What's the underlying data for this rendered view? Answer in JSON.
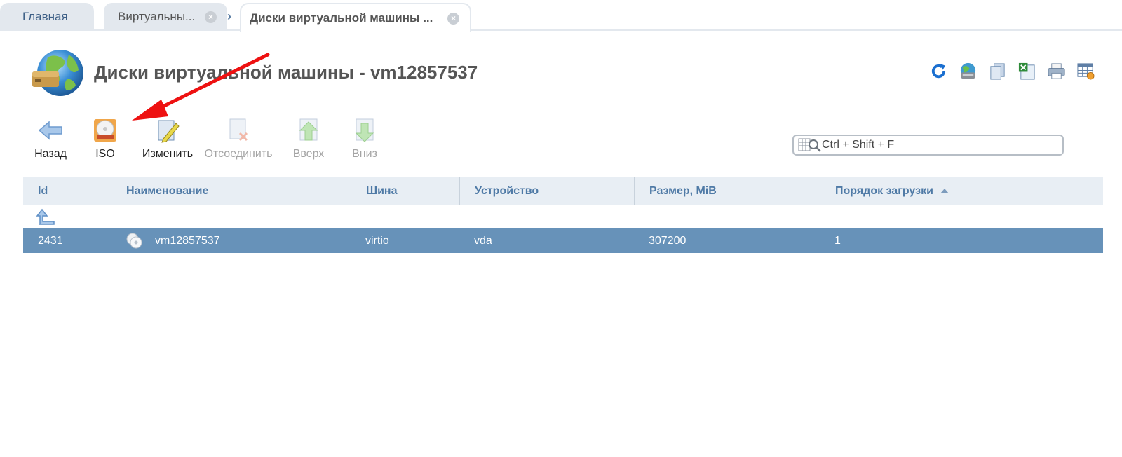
{
  "tabs": {
    "home": "Главная",
    "vm": "Виртуальны...",
    "current": "Диски виртуальной машины ..."
  },
  "page": {
    "title": "Диски виртуальной машины - vm12857537"
  },
  "top_actions": [
    {
      "icon": "refresh-icon"
    },
    {
      "icon": "globe-disk-icon"
    },
    {
      "icon": "copy-icon"
    },
    {
      "icon": "excel-export-icon"
    },
    {
      "icon": "print-icon"
    },
    {
      "icon": "table-settings-icon"
    }
  ],
  "toolbar": {
    "back": "Назад",
    "iso": "ISO",
    "edit": "Изменить",
    "detach": "Отсоединить",
    "up": "Вверх",
    "down": "Вниз"
  },
  "search": {
    "placeholder": "Ctrl + Shift + F"
  },
  "table": {
    "columns": {
      "id": "Id",
      "name": "Наименование",
      "bus": "Шина",
      "device": "Устройство",
      "size": "Размер, MiB",
      "boot_order": "Порядок загрузки"
    },
    "sorted_column": "boot_order",
    "sort_direction": "asc",
    "rows": [
      {
        "id": "2431",
        "name": "vm12857537",
        "bus": "virtio",
        "device": "vda",
        "size": "307200",
        "boot_order": "1",
        "selected": true
      }
    ]
  },
  "colors": {
    "accent": "#4f7aa6",
    "selected_row": "#6792b9",
    "header_bg": "#e8eef4",
    "annotation_arrow": "#ee1111"
  }
}
